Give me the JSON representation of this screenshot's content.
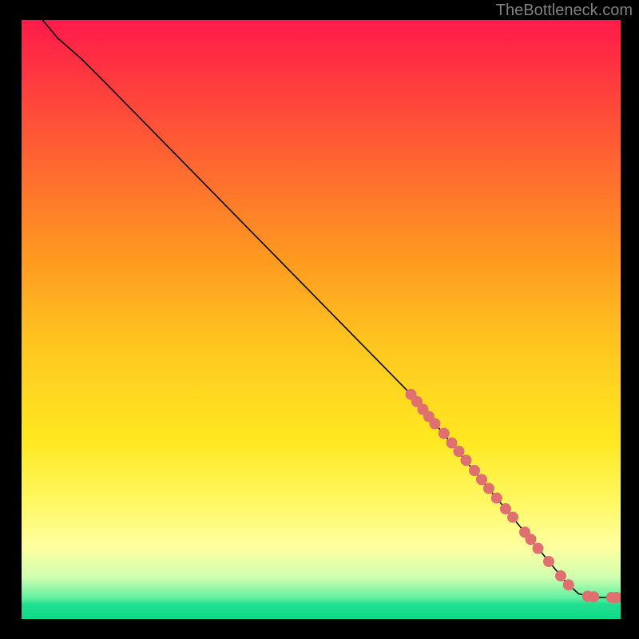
{
  "watermark": "TheBottleneck.com",
  "chart_data": {
    "type": "line",
    "title": "",
    "xlabel": "",
    "ylabel": "",
    "xlim": [
      0,
      100
    ],
    "ylim": [
      0,
      100
    ],
    "gradient_stops": [
      {
        "offset": 0.0,
        "color": "#ff1a4a"
      },
      {
        "offset": 0.1,
        "color": "#ff3a3f"
      },
      {
        "offset": 0.25,
        "color": "#ff6a30"
      },
      {
        "offset": 0.4,
        "color": "#ff9a20"
      },
      {
        "offset": 0.55,
        "color": "#ffc820"
      },
      {
        "offset": 0.7,
        "color": "#ffe820"
      },
      {
        "offset": 0.8,
        "color": "#fff860"
      },
      {
        "offset": 0.88,
        "color": "#ffffa0"
      },
      {
        "offset": 0.93,
        "color": "#d0ffb0"
      },
      {
        "offset": 0.965,
        "color": "#60f0a0"
      },
      {
        "offset": 0.975,
        "color": "#20e090"
      },
      {
        "offset": 1.0,
        "color": "#10d888"
      }
    ],
    "curve": [
      {
        "x": 3.5,
        "y": 100
      },
      {
        "x": 6,
        "y": 97
      },
      {
        "x": 10,
        "y": 93.5
      },
      {
        "x": 14,
        "y": 89.5
      },
      {
        "x": 65,
        "y": 37.5
      },
      {
        "x": 91,
        "y": 6
      },
      {
        "x": 93,
        "y": 4.2
      },
      {
        "x": 96,
        "y": 3.6
      },
      {
        "x": 99,
        "y": 3.6
      }
    ],
    "scatter_points": [
      {
        "x": 65.0,
        "y": 37.5
      },
      {
        "x": 66.0,
        "y": 36.3
      },
      {
        "x": 67.0,
        "y": 35.0
      },
      {
        "x": 68.0,
        "y": 33.8
      },
      {
        "x": 69.0,
        "y": 32.6
      },
      {
        "x": 70.5,
        "y": 31.0
      },
      {
        "x": 71.8,
        "y": 29.4
      },
      {
        "x": 73.0,
        "y": 28.0
      },
      {
        "x": 74.2,
        "y": 26.5
      },
      {
        "x": 75.6,
        "y": 24.8
      },
      {
        "x": 76.8,
        "y": 23.3
      },
      {
        "x": 78.0,
        "y": 21.8
      },
      {
        "x": 79.3,
        "y": 20.2
      },
      {
        "x": 80.8,
        "y": 18.4
      },
      {
        "x": 82.0,
        "y": 17.0
      },
      {
        "x": 84.0,
        "y": 14.5
      },
      {
        "x": 85.0,
        "y": 13.3
      },
      {
        "x": 86.2,
        "y": 11.8
      },
      {
        "x": 88.0,
        "y": 9.6
      },
      {
        "x": 90.0,
        "y": 7.2
      },
      {
        "x": 91.3,
        "y": 5.7
      },
      {
        "x": 94.5,
        "y": 3.8
      },
      {
        "x": 95.5,
        "y": 3.7
      },
      {
        "x": 98.5,
        "y": 3.6
      },
      {
        "x": 99.3,
        "y": 3.6
      }
    ],
    "point_color": "#e07070",
    "point_radius": 7
  }
}
